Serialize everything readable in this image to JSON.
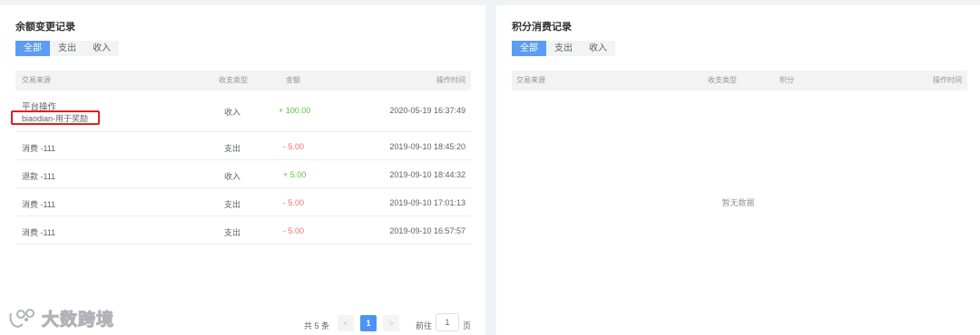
{
  "balance_panel": {
    "title": "余额变更记录",
    "tabs": [
      "全部",
      "支出",
      "收入"
    ],
    "columns": [
      "交易来源",
      "收支类型",
      "金额",
      "操作时间"
    ],
    "rows": [
      {
        "source": "平台操作",
        "source_note": "biaodian-用于奖励",
        "type": "收入",
        "amount": "+ 100.00",
        "time": "2020-05-19 16:37:49"
      },
      {
        "source": "消费 -111",
        "type": "支出",
        "amount": "- 5.00",
        "time": "2019-09-10 18:45:20"
      },
      {
        "source": "退款 -111",
        "type": "收入",
        "amount": "+ 5.00",
        "time": "2019-09-10 18:44:32"
      },
      {
        "source": "消费 -111",
        "type": "支出",
        "amount": "- 5.00",
        "time": "2019-09-10 17:01:13"
      },
      {
        "source": "消费 -111",
        "type": "支出",
        "amount": "- 5.00",
        "time": "2019-09-10 16:57:57"
      }
    ],
    "pagination": {
      "total": "共 5 条",
      "prev": "<",
      "current_page": "1",
      "next": ">",
      "goto_label": "前往",
      "goto_value": "1",
      "page_unit": "页"
    }
  },
  "points_panel": {
    "title": "积分消费记录",
    "tabs": [
      "全部",
      "支出",
      "收入"
    ],
    "columns": [
      "交易来源",
      "收支类型",
      "积分",
      "操作时间"
    ],
    "empty_text": "暂无数据"
  },
  "watermark": {
    "text": "大数跨境"
  },
  "colors": {
    "accent": "#5b9cf6",
    "income": "#67c23a",
    "expense": "#f56c6c",
    "highlight": "#e02020"
  }
}
